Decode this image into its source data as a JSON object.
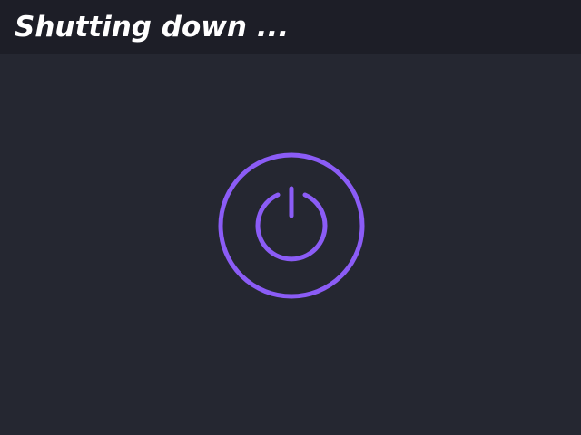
{
  "header": {
    "title": "Shutting down ..."
  },
  "main": {
    "icon": "power-icon"
  },
  "colors": {
    "header_background": "#1d1e27",
    "background": "#252731",
    "title_text": "#ffffff",
    "accent": "#8b5cf6"
  }
}
